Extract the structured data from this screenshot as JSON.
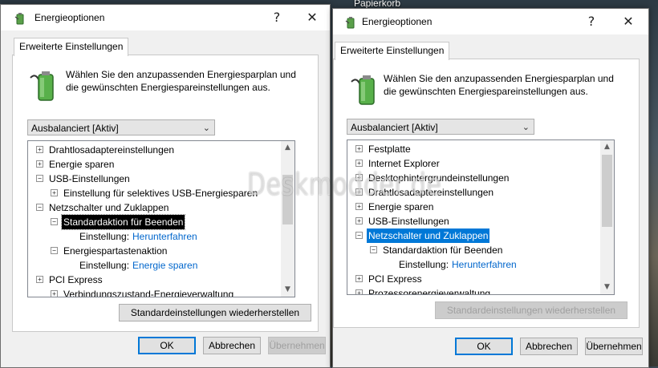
{
  "desktop": {
    "label": "Papierkorb"
  },
  "watermark": "Deskmodder.de",
  "dialog_left": {
    "title": "Energieoptionen",
    "help": "?",
    "close": "✕",
    "tab": "Erweiterte Einstellungen",
    "intro": "Wählen Sie den anzupassenden Energiesparplan und die gewünschten Energiespareinstellungen aus.",
    "plan": "Ausbalanciert [Aktiv]",
    "tree": [
      {
        "label": "Drahtlosadaptereinstellungen",
        "exp": "+"
      },
      {
        "label": "Energie sparen",
        "exp": "+"
      },
      {
        "label": "USB-Einstellungen",
        "exp": "−"
      },
      {
        "label": "Einstellung für selektives USB-Energiesparen",
        "exp": "+"
      },
      {
        "label": "Netzschalter und Zuklappen",
        "exp": "−"
      },
      {
        "label": "Standardaktion für Beenden",
        "exp": "−"
      },
      {
        "label": "Einstellung:",
        "value": "Herunterfahren"
      },
      {
        "label": "Energiespartastenaktion",
        "exp": "−"
      },
      {
        "label": "Einstellung:",
        "value": "Energie sparen"
      },
      {
        "label": "PCI Express",
        "exp": "+"
      },
      {
        "label": "Verbindungszustand-Energieverwaltung",
        "exp": "+"
      }
    ],
    "restore": "Standardeinstellungen wiederherstellen",
    "ok": "OK",
    "cancel": "Abbrechen",
    "apply": "Übernehmen"
  },
  "dialog_right": {
    "title": "Energieoptionen",
    "help": "?",
    "close": "✕",
    "tab": "Erweiterte Einstellungen",
    "intro": "Wählen Sie den anzupassenden Energiesparplan und die gewünschten Energiespareinstellungen aus.",
    "plan": "Ausbalanciert [Aktiv]",
    "tree": [
      {
        "label": "Festplatte",
        "exp": "+"
      },
      {
        "label": "Internet Explorer",
        "exp": "+"
      },
      {
        "label": "Desktophintergrundeinstellungen",
        "exp": "+"
      },
      {
        "label": "Drahtlosadaptereinstellungen",
        "exp": "+"
      },
      {
        "label": "Energie sparen",
        "exp": "+"
      },
      {
        "label": "USB-Einstellungen",
        "exp": "+"
      },
      {
        "label": "Netzschalter und Zuklappen",
        "exp": "−"
      },
      {
        "label": "Standardaktion für Beenden",
        "exp": "−"
      },
      {
        "label": "Einstellung:",
        "value": "Herunterfahren"
      },
      {
        "label": "PCI Express",
        "exp": "+"
      },
      {
        "label": "Prozessorenergieverwaltung",
        "exp": "+"
      }
    ],
    "restore": "Standardeinstellungen wiederherstellen",
    "ok": "OK",
    "cancel": "Abbrechen",
    "apply": "Übernehmen"
  }
}
